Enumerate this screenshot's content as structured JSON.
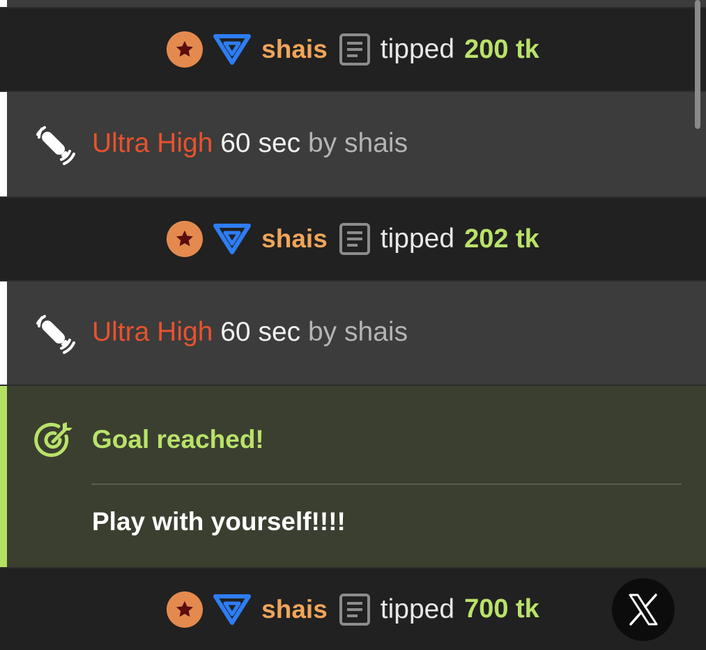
{
  "feed": {
    "tip_1": {
      "username": "shais",
      "action": "tipped",
      "amount": "200 tk"
    },
    "vibe_1": {
      "level": "Ultra High",
      "duration": "60 sec",
      "by_prefix": "by",
      "username": "shais"
    },
    "tip_2": {
      "username": "shais",
      "action": "tipped",
      "amount": "202 tk"
    },
    "vibe_2": {
      "level": "Ultra High",
      "duration": "60 sec",
      "by_prefix": "by",
      "username": "shais"
    },
    "goal": {
      "title": "Goal reached!",
      "message": "Play with yourself!!!!"
    },
    "tip_3": {
      "username": "shais",
      "action": "tipped",
      "amount": "700 tk"
    }
  },
  "icons": {
    "badge": "star-badge-icon",
    "rank": "triangle-rank-icon",
    "notes": "document-icon",
    "vibe": "vibrator-icon",
    "goal": "target-icon",
    "close": "x-icon"
  },
  "colors": {
    "username": "#f0a55a",
    "amount": "#b9e26a",
    "level_ultra_high": "#e8522e",
    "goal_accent": "#b5e061",
    "rank_blue": "#2e7df5",
    "badge_orange": "#e48a4f"
  }
}
